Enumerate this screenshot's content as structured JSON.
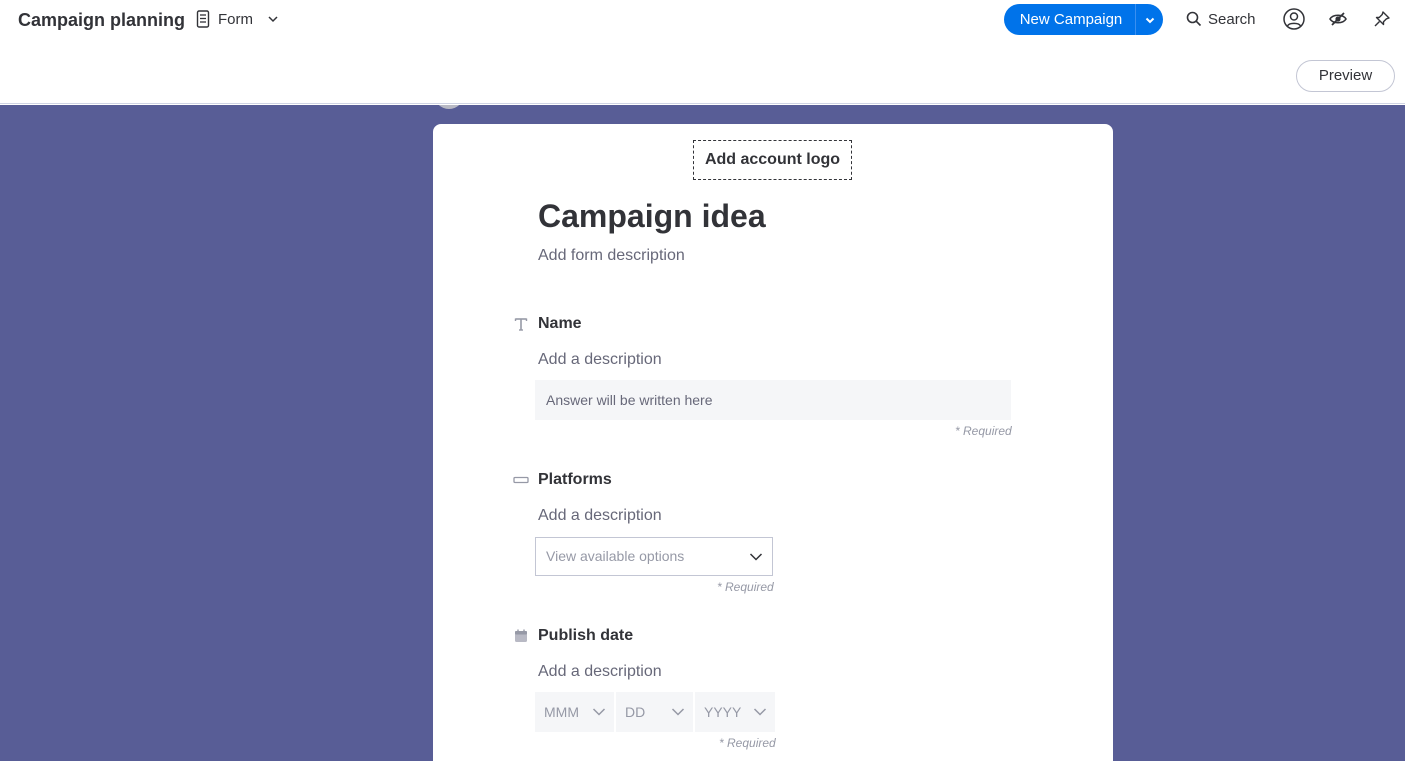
{
  "header": {
    "board_title": "Campaign planning",
    "view_label": "Form",
    "new_button_label": "New Campaign",
    "search_label": "Search",
    "preview_label": "Preview",
    "icons": [
      "document-icon",
      "chevron-down-icon",
      "search-icon",
      "user-circle-icon",
      "eye-slash-icon",
      "pin-icon"
    ]
  },
  "colors": {
    "canvas_background": "#585d96",
    "primary": "#0073ea",
    "card_background": "#ffffff"
  },
  "form": {
    "logo_label": "Add account logo",
    "title": "Campaign idea",
    "description_placeholder": "Add form description",
    "questions": [
      {
        "icon": "text-type-icon",
        "label": "Name",
        "description_placeholder": "Add a description",
        "answer_placeholder": "Answer will be written here",
        "required": "* Required"
      },
      {
        "icon": "dropdown-type-icon",
        "label": "Platforms",
        "description_placeholder": "Add a description",
        "select_placeholder": "View available options",
        "required": "* Required"
      },
      {
        "icon": "calendar-type-icon",
        "label": "Publish date",
        "description_placeholder": "Add a description",
        "date_parts": [
          "MMM",
          "DD",
          "YYYY"
        ],
        "required": "* Required"
      }
    ]
  }
}
